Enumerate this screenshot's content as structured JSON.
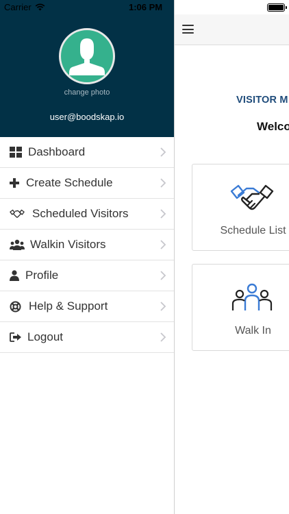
{
  "status_bar": {
    "carrier": "Carrier",
    "time": "1:06 PM"
  },
  "drawer": {
    "change_photo": "change photo",
    "email": "user@boodskap.io",
    "header_color": "#023146",
    "avatar_color": "#35b18d",
    "menu": [
      {
        "label": "Dashboard",
        "icon": "dashboard-icon"
      },
      {
        "label": "Create Schedule",
        "icon": "plus-icon"
      },
      {
        "label": "Scheduled Visitors",
        "icon": "handshake-icon"
      },
      {
        "label": "Walkin Visitors",
        "icon": "users-icon"
      },
      {
        "label": "Profile",
        "icon": "user-icon"
      },
      {
        "label": "Help & Support",
        "icon": "lifebuoy-icon"
      },
      {
        "label": "Logout",
        "icon": "sign-out-icon"
      }
    ]
  },
  "main": {
    "heading": "VISITOR M",
    "welcome": "Welco",
    "heading_color": "#1e4b7a",
    "cards": [
      {
        "label": "Schedule List",
        "icon": "handshake-icon"
      },
      {
        "label": "Walk In",
        "icon": "group-icon"
      }
    ]
  }
}
